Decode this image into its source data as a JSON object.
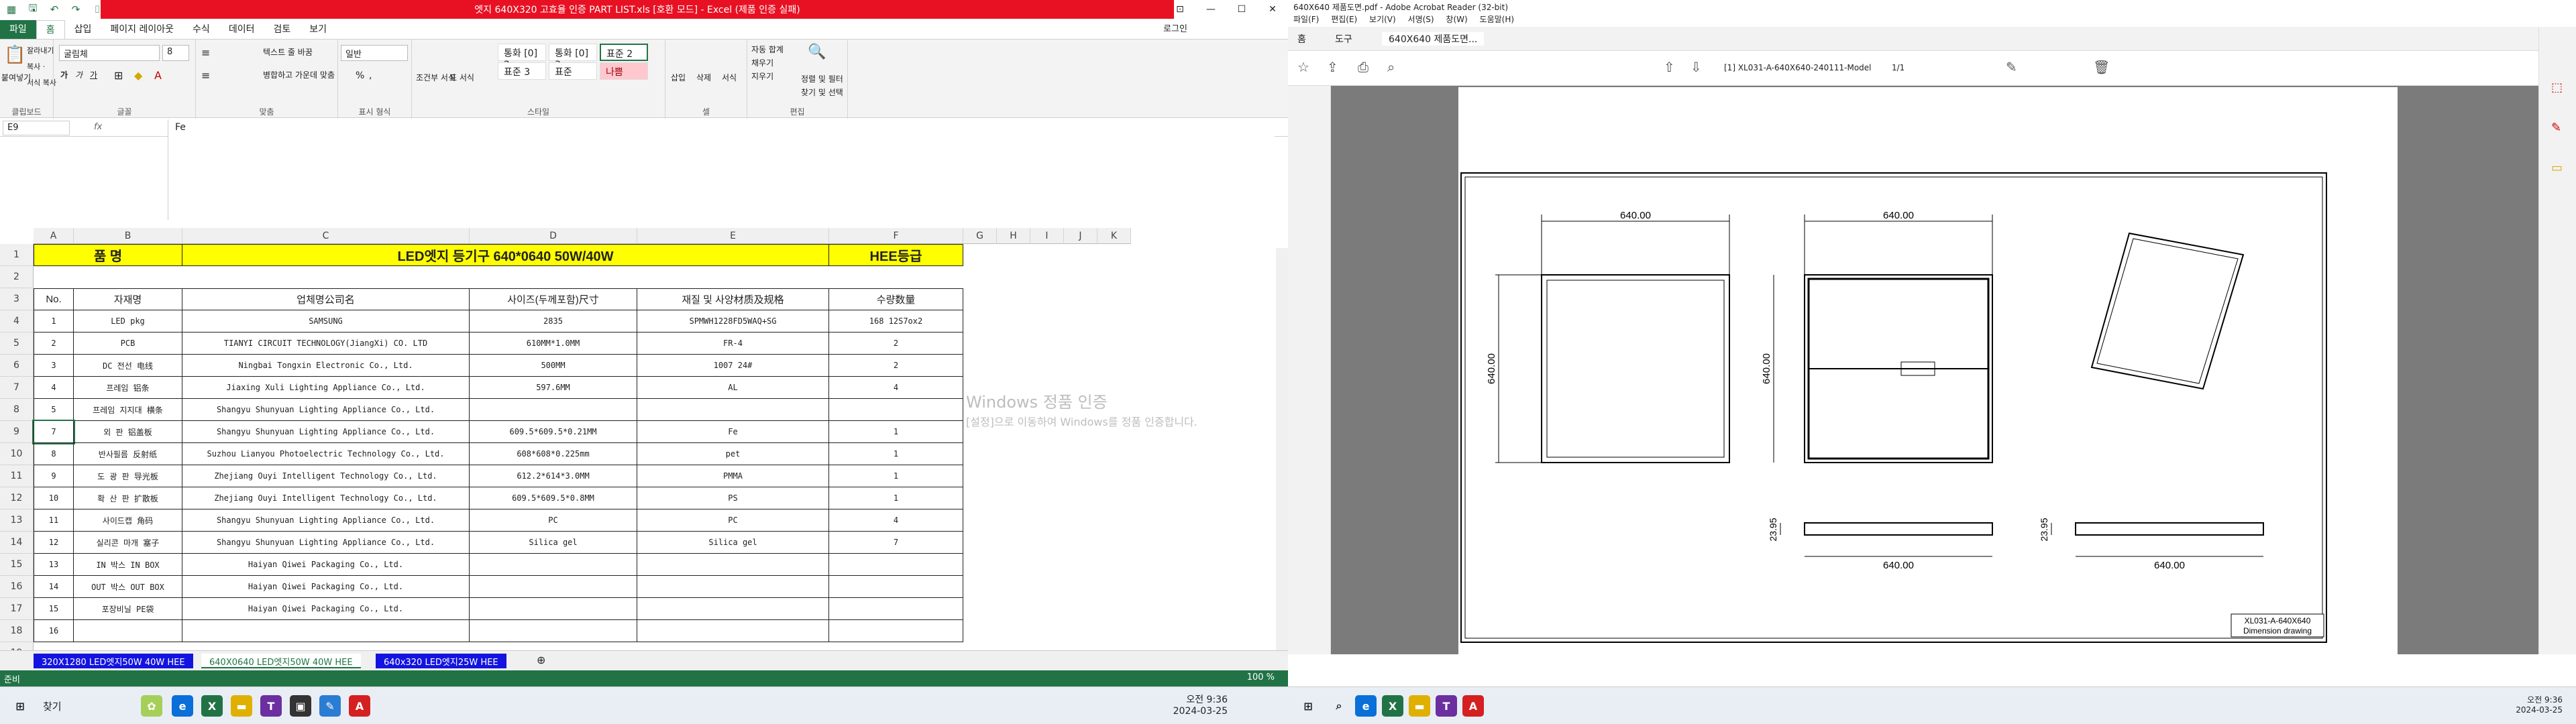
{
  "excel": {
    "window_title": "엣지 640X320 고효율 인증 PART LIST.xls [호환 모드] - Excel (제품 인증 실패)",
    "login": "로그인",
    "tabs": [
      "파일",
      "홈",
      "삽입",
      "페이지 레이아웃",
      "수식",
      "데이터",
      "검토",
      "보기"
    ],
    "ribbon": {
      "clipboard": {
        "paste": "붙여넣기",
        "cut": "잘라내기",
        "copy": "복사 ·",
        "format_painter": "서식 복사",
        "label": "클립보드"
      },
      "font": {
        "name": "굴림체",
        "size": "8",
        "grow": "가",
        "shrink": "가",
        "bold": "가",
        "italic": "가",
        "underline": "가",
        "label": "글꼴"
      },
      "align": {
        "wrap": "텍스트 줄 바꿈",
        "merge": "병합하고 가운데 맞춤",
        "label": "맞춤"
      },
      "number": {
        "format": "일반",
        "pct": "%",
        "comma": ",",
        "label": "표시 형식"
      },
      "styles": {
        "cond": "조건부 서식",
        "table": "표 서식",
        "items": [
          "통화 [0] 2",
          "통화 [0] 3",
          "표준 2",
          "표준 3",
          "표준",
          "나쁨"
        ],
        "label": "스타일"
      },
      "cells": {
        "insert": "삽입",
        "delete": "삭제",
        "format": "서식",
        "label": "셀"
      },
      "edit": {
        "autosum": "자동 합계",
        "fill": "채우기",
        "clear": "지우기",
        "sort": "정렬 및 필터",
        "find": "찾기 및 선택",
        "label": "편집"
      }
    },
    "namebox": "E9",
    "fx": "fx",
    "formula": "Fe",
    "columns": [
      "A",
      "B",
      "C",
      "D",
      "E",
      "F",
      "G",
      "H",
      "I",
      "J",
      "K"
    ],
    "title_row": {
      "col_a": "품 명",
      "col_c": "LED엣지 등기구 640*0640 50W/40W",
      "col_f": "HEE등급"
    },
    "header_row": [
      "No.",
      "자재명",
      "업체명公司名",
      "사이즈(두께포함)尺寸",
      "재질 및 사양材质及规格",
      "수량数量"
    ],
    "rows": [
      [
        "1",
        "LED pkg",
        "SAMSUNG",
        "2835",
        "SPMWH1228FD5WAQ+SG",
        "168 12S7ox2"
      ],
      [
        "2",
        "PCB",
        "TIANYI CIRCUIT TECHNOLOGY(JiangXi) CO. LTD",
        "610MM*1.0MM",
        "FR-4",
        "2"
      ],
      [
        "3",
        "DC 전선 电线",
        "Ningbai Tongxin Electronic Co., Ltd.",
        "500MM",
        "1007 24#",
        "2"
      ],
      [
        "4",
        "프레임 铝条",
        "Jiaxing Xuli Lighting Appliance Co., Ltd.",
        "597.6MM",
        "AL",
        "4"
      ],
      [
        "5",
        "프레임 지지대 横条",
        "Shangyu Shunyuan Lighting Appliance Co., Ltd.",
        "",
        "",
        ""
      ],
      [
        "7",
        "외   판 铝盖板",
        "Shangyu Shunyuan Lighting Appliance Co., Ltd.",
        "609.5*609.5*0.21MM",
        "Fe",
        "1"
      ],
      [
        "8",
        "반사필름 反射纸",
        "Suzhou Lianyou Photoelectric Technology Co., Ltd.",
        "608*608*0.225mm",
        "pet",
        "1"
      ],
      [
        "9",
        "도 광 판 导光板",
        "Zhejiang Ouyi Intelligent Technology Co., Ltd.",
        "612.2*614*3.0MM",
        "PMMA",
        "1"
      ],
      [
        "10",
        "확 산 판 扩散板",
        "Zhejiang Ouyi Intelligent Technology Co., Ltd.",
        "609.5*609.5*0.8MM",
        "PS",
        "1"
      ],
      [
        "11",
        "사이드캡 角码",
        "Shangyu Shunyuan Lighting Appliance Co., Ltd.",
        "PC",
        "PC",
        "4"
      ],
      [
        "12",
        "실리콘 마개 塞子",
        "Shangyu Shunyuan Lighting Appliance Co., Ltd.",
        "Silica gel",
        "Silica gel",
        "7"
      ],
      [
        "13",
        "IN 박스 IN BOX",
        "Haiyan Qiwei Packaging Co., Ltd.",
        "",
        "",
        ""
      ],
      [
        "14",
        "OUT 박스 OUT BOX",
        "Haiyan Qiwei Packaging Co., Ltd.",
        "",
        "",
        ""
      ],
      [
        "15",
        "포장비닐 PE袋",
        "Haiyan Qiwei Packaging Co., Ltd.",
        "",
        "",
        ""
      ],
      [
        "16",
        "",
        "",
        "",
        "",
        ""
      ]
    ],
    "row_numbers": [
      "1",
      "2",
      "3",
      "4",
      "5",
      "6",
      "7",
      "8",
      "9",
      "10",
      "11",
      "12",
      "13",
      "14",
      "15",
      "16",
      "17",
      "18",
      "19"
    ],
    "watermark": {
      "line1": "Windows 정품 인증",
      "line2": "[설정]으로 이동하여 Windows를 정품 인증합니다."
    },
    "sheets": [
      "320X1280 LED엣지50W 40W HEE",
      "640X0640 LED엣지50W 40W HEE",
      "640x320 LED엣지25W HEE"
    ],
    "status": {
      "ready": "준비",
      "zoom": "100 %"
    },
    "taskbar": {
      "search": "찾기",
      "time": "오전 9:36",
      "date": "2024-03-25"
    }
  },
  "acrobat": {
    "window_title": "640X640 제품도면.pdf - Adobe Acrobat Reader (32-bit)",
    "menu": [
      "파일(F)",
      "편집(E)",
      "보기(V)",
      "서명(S)",
      "창(W)",
      "도움말(H)"
    ],
    "tabs": [
      "홈",
      "도구",
      "640X640 제품도면..."
    ],
    "page_label": "[1] XL031-A-640X640-240111-Model",
    "page_count": "1/1",
    "drawing": {
      "dims": [
        "640.00",
        "640.00",
        "640.00",
        "640.00",
        "23.95",
        "640.00",
        "23.95",
        "640.00"
      ],
      "code": "XL031-A-640X640",
      "caption": "Dimension drawing"
    },
    "taskbar": {
      "time": "오전 9:36",
      "date": "2024-03-25"
    }
  }
}
